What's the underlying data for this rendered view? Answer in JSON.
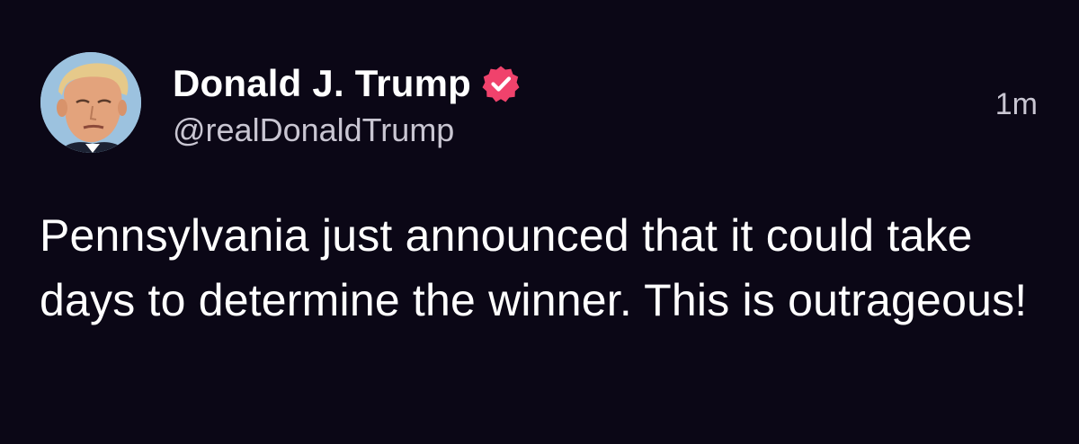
{
  "post": {
    "author": {
      "display_name": "Donald J. Trump",
      "handle": "@realDonaldTrump",
      "verified": true,
      "avatar_icon": "profile-photo-avatar"
    },
    "timestamp": "1m",
    "text": "Pennsylvania just announced that it could take days to determine the winner. This is outrageous!"
  },
  "colors": {
    "background": "#0b0716",
    "text": "#ffffff",
    "secondary_text": "#c9c6d2",
    "verified_badge": "#f0426c"
  },
  "icons": {
    "verified": "verified-badge-icon"
  }
}
